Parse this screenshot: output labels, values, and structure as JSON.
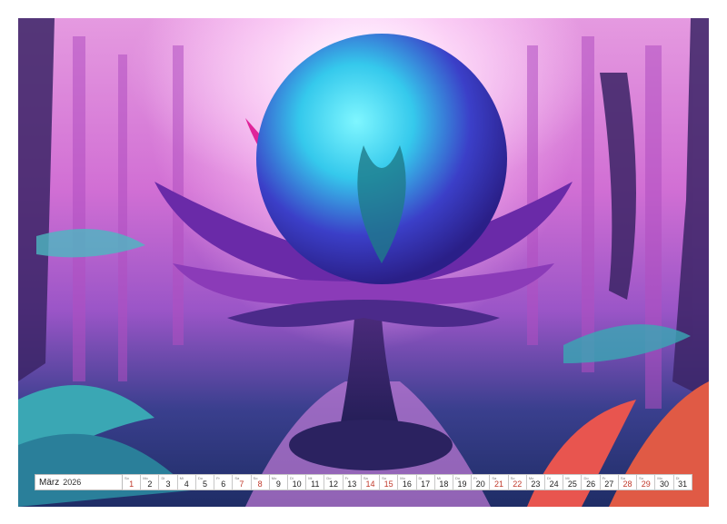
{
  "calendar": {
    "month": "März",
    "year": "2026",
    "days": [
      {
        "num": "1",
        "wd": "So",
        "weekend": true
      },
      {
        "num": "2",
        "wd": "Mo",
        "weekend": false
      },
      {
        "num": "3",
        "wd": "Di",
        "weekend": false
      },
      {
        "num": "4",
        "wd": "Mi",
        "weekend": false
      },
      {
        "num": "5",
        "wd": "Do",
        "weekend": false
      },
      {
        "num": "6",
        "wd": "Fr",
        "weekend": false
      },
      {
        "num": "7",
        "wd": "Sa",
        "weekend": true
      },
      {
        "num": "8",
        "wd": "So",
        "weekend": true
      },
      {
        "num": "9",
        "wd": "Mo",
        "weekend": false
      },
      {
        "num": "10",
        "wd": "Di",
        "weekend": false
      },
      {
        "num": "11",
        "wd": "Mi",
        "weekend": false
      },
      {
        "num": "12",
        "wd": "Do",
        "weekend": false
      },
      {
        "num": "13",
        "wd": "Fr",
        "weekend": false
      },
      {
        "num": "14",
        "wd": "Sa",
        "weekend": true
      },
      {
        "num": "15",
        "wd": "So",
        "weekend": true
      },
      {
        "num": "16",
        "wd": "Mo",
        "weekend": false
      },
      {
        "num": "17",
        "wd": "Di",
        "weekend": false
      },
      {
        "num": "18",
        "wd": "Mi",
        "weekend": false
      },
      {
        "num": "19",
        "wd": "Do",
        "weekend": false
      },
      {
        "num": "20",
        "wd": "Fr",
        "weekend": false
      },
      {
        "num": "21",
        "wd": "Sa",
        "weekend": true
      },
      {
        "num": "22",
        "wd": "So",
        "weekend": true
      },
      {
        "num": "23",
        "wd": "Mo",
        "weekend": false
      },
      {
        "num": "24",
        "wd": "Di",
        "weekend": false
      },
      {
        "num": "25",
        "wd": "Mi",
        "weekend": false
      },
      {
        "num": "26",
        "wd": "Do",
        "weekend": false
      },
      {
        "num": "27",
        "wd": "Fr",
        "weekend": false
      },
      {
        "num": "28",
        "wd": "Sa",
        "weekend": true
      },
      {
        "num": "29",
        "wd": "So",
        "weekend": true
      },
      {
        "num": "30",
        "wd": "Mo",
        "weekend": false
      },
      {
        "num": "31",
        "wd": "Di",
        "weekend": false
      }
    ]
  },
  "colors": {
    "sky": "#f4b6ee",
    "forest_pink": "#d66fd6",
    "orb_cyan": "#35e0f0",
    "orb_blue": "#3b3fc8",
    "petal_magenta": "#e0249a",
    "petal_purple": "#6a2aa8",
    "ground_dark": "#1f2d66",
    "fern_teal": "#3aa7b4",
    "fern_red": "#e8554f",
    "weekend_red": "#c0392b"
  }
}
